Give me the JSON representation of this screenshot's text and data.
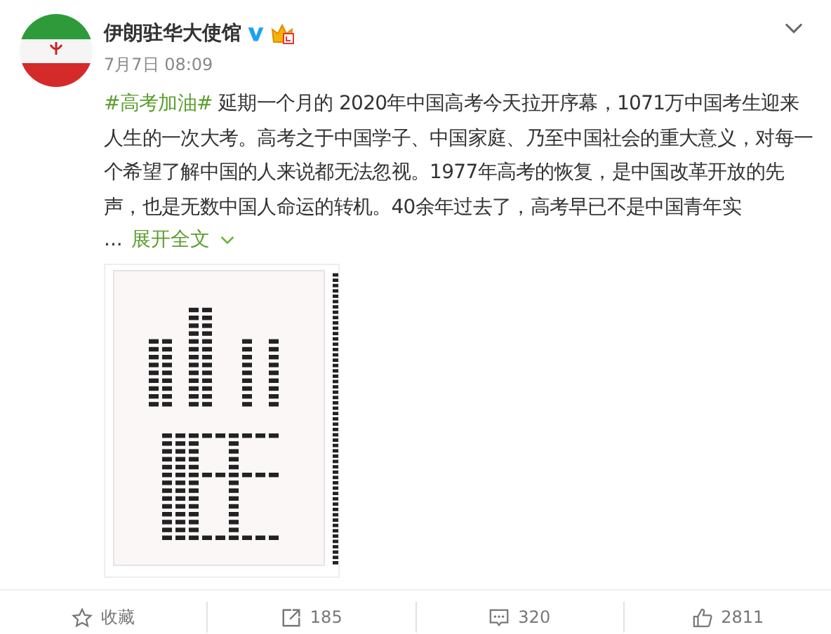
{
  "post": {
    "author": "伊朗驻华大使馆",
    "verified": true,
    "time": "7月7日 08:09",
    "hashtag": "#高考加油#",
    "text": " 延期一个月的 2020年中国高考今天拉开序幕，1071万中国考生迎来人生的一次大考。高考之于中国学子、中国家庭、乃至中国社会的重大意义，对每一个希望了解中国的人来说都无法忽视。1977年高考的恢复，是中国改革开放的先声，也是无数中国人命运的转机。40余年过去了，高考早已不是中国青年实",
    "ellipsis": "...",
    "expand": "展开全文"
  },
  "actions": [
    {
      "kind": "favorite",
      "label": "收藏"
    },
    {
      "kind": "repost",
      "label": "185"
    },
    {
      "kind": "comment",
      "label": "320"
    },
    {
      "kind": "like",
      "label": "2811"
    }
  ]
}
